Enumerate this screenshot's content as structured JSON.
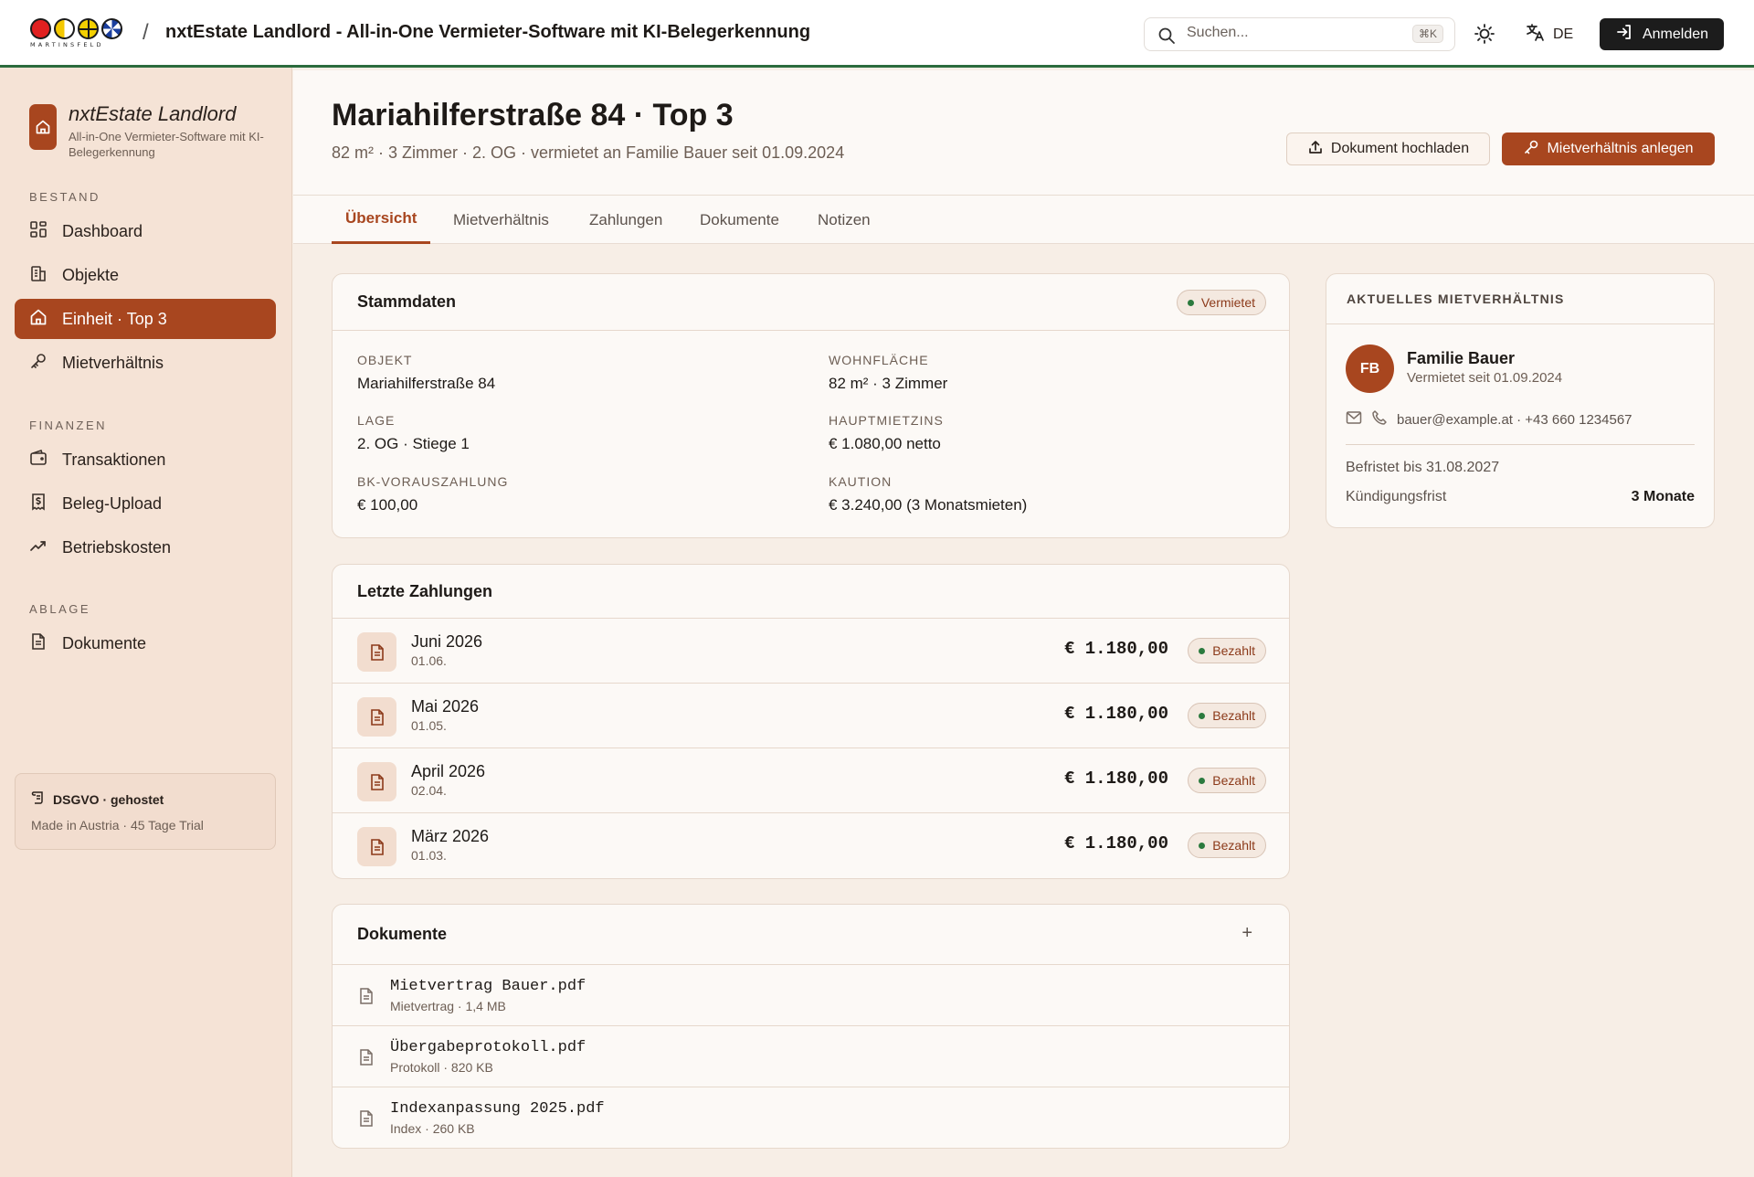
{
  "topbar": {
    "brand_word": "MARTINSFELD",
    "separator": "/",
    "app_title": "nxtEstate Landlord - All-in-One Vermieter-Software mit KI-Belegerkennung",
    "search_placeholder": "Suchen...",
    "search_shortcut": "⌘K",
    "language": "DE",
    "login_label": "Anmelden"
  },
  "sidebar": {
    "brand_name": "nxtEstate Landlord",
    "brand_sub": "All-in-One Vermieter-Software mit KI-Belegerkennung",
    "sections": [
      {
        "title": "BESTAND",
        "items": [
          {
            "label": "Dashboard",
            "icon": "dashboard-icon"
          },
          {
            "label": "Objekte",
            "icon": "building-icon"
          },
          {
            "label": "Einheit · Top 3",
            "icon": "home-icon",
            "active": true
          },
          {
            "label": "Mietverhältnis",
            "icon": "key-icon"
          }
        ]
      },
      {
        "title": "FINANZEN",
        "items": [
          {
            "label": "Transaktionen",
            "icon": "wallet-icon"
          },
          {
            "label": "Beleg-Upload",
            "icon": "receipt-icon"
          },
          {
            "label": "Betriebskosten",
            "icon": "trend-icon"
          }
        ]
      },
      {
        "title": "ABLAGE",
        "items": [
          {
            "label": "Dokumente",
            "icon": "document-icon"
          }
        ]
      }
    ],
    "footer_title": "DSGVO · gehostet",
    "footer_sub": "Made in Austria · 45 Tage Trial"
  },
  "header": {
    "title": "Mariahilferstraße 84 · Top 3",
    "subtitle": "82 m² · 3 Zimmer · 2. OG · vermietet an Familie Bauer seit 01.09.2024",
    "upload_label": "Dokument hochladen",
    "create_label": "Mietverhältnis anlegen"
  },
  "tabs": [
    "Übersicht",
    "Mietverhältnis",
    "Zahlungen",
    "Dokumente",
    "Notizen"
  ],
  "stammdaten": {
    "title": "Stammdaten",
    "status": "Vermietet",
    "fields": [
      {
        "label": "OBJEKT",
        "value": "Mariahilferstraße 84"
      },
      {
        "label": "WOHNFLÄCHE",
        "value": "82 m² · 3 Zimmer"
      },
      {
        "label": "LAGE",
        "value": "2. OG · Stiege 1"
      },
      {
        "label": "HAUPTMIETZINS",
        "value": "€ 1.080,00 netto"
      },
      {
        "label": "BK-VORAUSZAHLUNG",
        "value": "€ 100,00"
      },
      {
        "label": "KAUTION",
        "value": "€ 3.240,00 (3 Monatsmieten)"
      }
    ]
  },
  "payments": {
    "title": "Letzte Zahlungen",
    "rows": [
      {
        "month": "Juni 2026",
        "date": "01.06.",
        "amount": "€ 1.180,00",
        "status": "Bezahlt"
      },
      {
        "month": "Mai 2026",
        "date": "01.05.",
        "amount": "€ 1.180,00",
        "status": "Bezahlt"
      },
      {
        "month": "April 2026",
        "date": "02.04.",
        "amount": "€ 1.180,00",
        "status": "Bezahlt"
      },
      {
        "month": "März 2026",
        "date": "01.03.",
        "amount": "€ 1.180,00",
        "status": "Bezahlt"
      }
    ]
  },
  "documents": {
    "title": "Dokumente",
    "add_label": "+",
    "rows": [
      {
        "name": "Mietvertrag Bauer.pdf",
        "meta": "Mietvertrag · 1,4 MB"
      },
      {
        "name": "Übergabeprotokoll.pdf",
        "meta": "Protokoll · 820 KB"
      },
      {
        "name": "Indexanpassung 2025.pdf",
        "meta": "Index · 260 KB"
      }
    ]
  },
  "tenancy": {
    "title": "AKTUELLES MIETVERHÄLTNIS",
    "initials": "FB",
    "name": "Familie Bauer",
    "since": "Vermietet seit 01.09.2024",
    "contact": "bauer@example.at · +43 660 1234567",
    "term": "Befristet bis 31.08.2027",
    "notice_label": "Kündigungsfrist",
    "notice_value": "3 Monate"
  },
  "colors": {
    "accent": "#a8461f",
    "sidebar_bg": "#f5e3d6",
    "page_bg": "#f7eee6",
    "paid_dot": "#2b7a3e",
    "topbar_line": "#2b6b3d"
  }
}
